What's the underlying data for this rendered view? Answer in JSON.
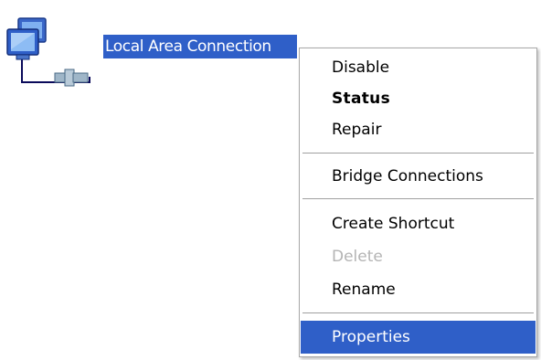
{
  "desktop": {
    "connection_label": "Local Area Connection",
    "connection_icon": "network-connection-icon"
  },
  "context_menu": {
    "items": [
      {
        "label": "Disable",
        "style": "normal"
      },
      {
        "label": "Status",
        "style": "bold"
      },
      {
        "label": "Repair",
        "style": "normal"
      },
      {
        "label": "Bridge Connections",
        "style": "normal"
      },
      {
        "label": "Create Shortcut",
        "style": "normal"
      },
      {
        "label": "Delete",
        "style": "disabled"
      },
      {
        "label": "Rename",
        "style": "normal"
      },
      {
        "label": "Properties",
        "style": "selected"
      }
    ]
  },
  "colors": {
    "selection": "#2f5fc8",
    "disabled_text": "#b4b4b4",
    "separator": "#a0a0a0"
  }
}
